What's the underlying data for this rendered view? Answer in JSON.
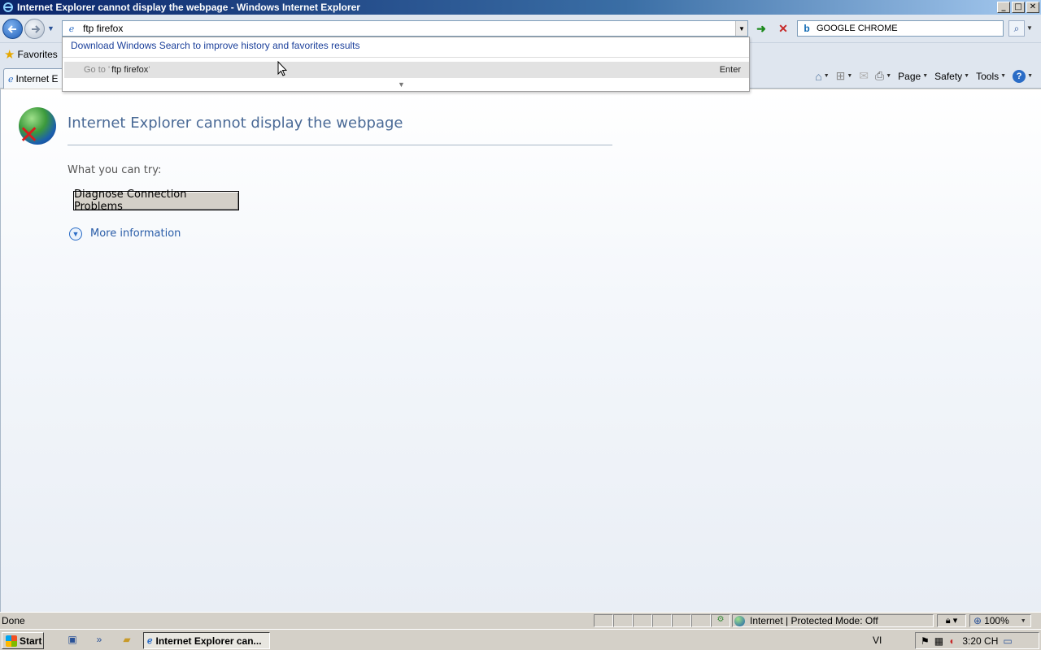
{
  "window": {
    "title": "Internet Explorer cannot display the webpage - Windows Internet Explorer",
    "buttons": [
      "_",
      "□",
      "✕"
    ]
  },
  "address_bar": {
    "value": "ftp firefox"
  },
  "search_bar": {
    "value": "GOOGLE CHROME"
  },
  "favorites": {
    "label": "Favorites"
  },
  "tab": {
    "label": "Internet E"
  },
  "commands": {
    "page": "Page",
    "safety": "Safety",
    "tools": "Tools"
  },
  "autocomplete": {
    "download_link": "Download Windows Search to improve history and favorites results",
    "goto_prefix": "Go to '",
    "goto_value": "ftp firefox",
    "goto_suffix": "'",
    "enter_hint": "Enter"
  },
  "error_page": {
    "title": "Internet Explorer cannot display the webpage",
    "try_label": "What you can try:",
    "diagnose_button": "Diagnose Connection Problems",
    "more_info": "More information"
  },
  "status_bar": {
    "status": "Done",
    "zone": "Internet | Protected Mode: Off",
    "zoom": "100%"
  },
  "taskbar": {
    "start": "Start",
    "task_button": "Internet Explorer can...",
    "language": "VI",
    "clock": "3:20 CH"
  }
}
